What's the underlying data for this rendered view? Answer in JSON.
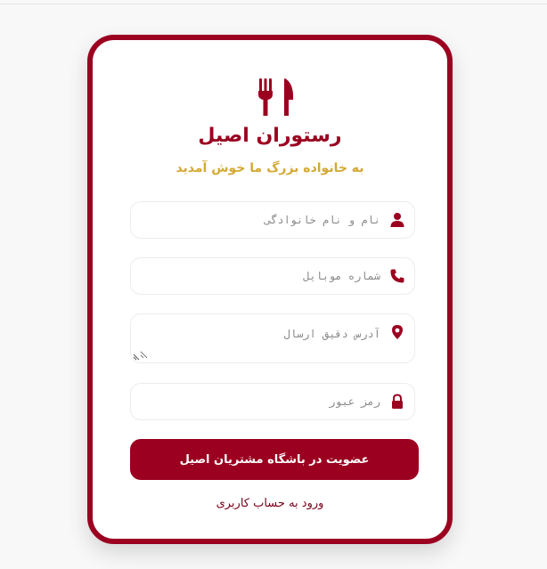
{
  "brand": {
    "title": "رستوران اصیل",
    "subtitle": "به خانواده بزرگ ما خوش آمدید",
    "logo_icon": "utensils-icon"
  },
  "form": {
    "fullname": {
      "placeholder": "نام و نام خانوادگی",
      "value": "",
      "icon": "user-icon"
    },
    "mobile": {
      "placeholder": "شماره موبایل",
      "value": "",
      "icon": "phone-icon"
    },
    "address": {
      "placeholder": "آدرس دقیق ارسال",
      "value": "",
      "icon": "map-pin-icon"
    },
    "password": {
      "placeholder": "رمز عبور",
      "value": "",
      "icon": "lock-icon"
    },
    "submit_label": "عضویت در باشگاه مشتریان اصیل",
    "login_link": "ورود به حساب کاربری"
  },
  "colors": {
    "primary": "#9b0020",
    "accent": "#d4a933",
    "background": "#f8f8f8"
  }
}
